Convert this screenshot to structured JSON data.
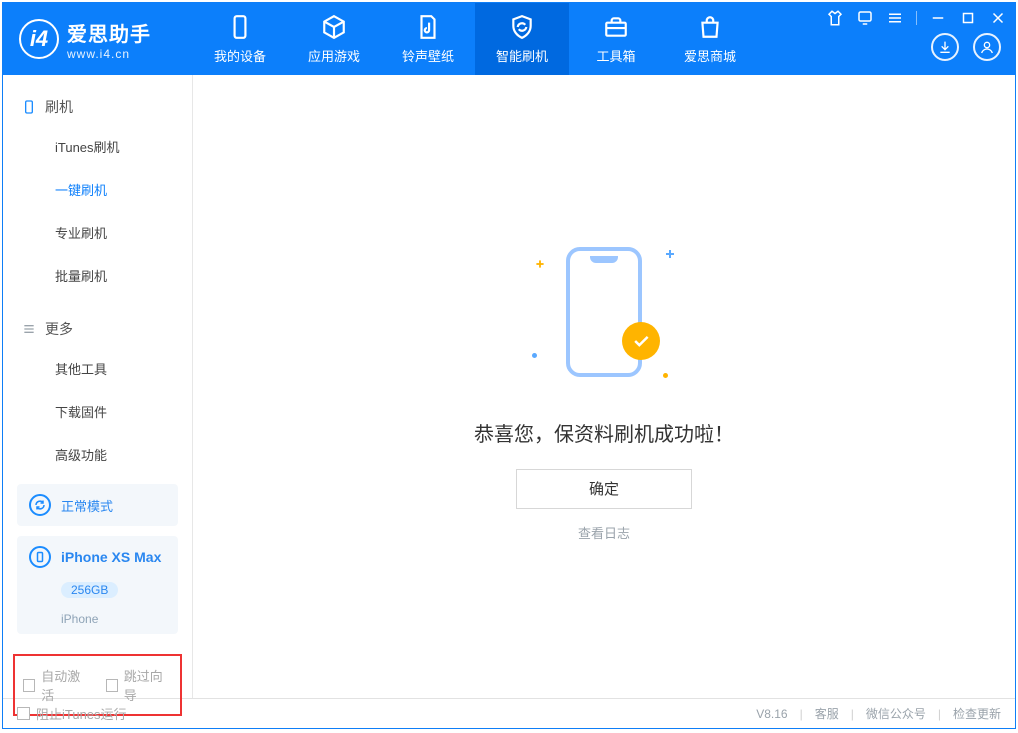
{
  "brand": {
    "title": "爱思助手",
    "subtitle": "www.i4.cn"
  },
  "tabs": {
    "device": "我的设备",
    "apps": "应用游戏",
    "rings": "铃声壁纸",
    "flash": "智能刷机",
    "tools": "工具箱",
    "store": "爱思商城"
  },
  "sidebar": {
    "heading_flash": "刷机",
    "items_flash": [
      "iTunes刷机",
      "一键刷机",
      "专业刷机",
      "批量刷机"
    ],
    "active_flash_index": 1,
    "heading_more": "更多",
    "items_more": [
      "其他工具",
      "下载固件",
      "高级功能"
    ]
  },
  "device_card": {
    "mode_label": "正常模式",
    "name": "iPhone XS Max",
    "storage": "256GB",
    "type": "iPhone"
  },
  "options": {
    "auto_activate": "自动激活",
    "skip_guide": "跳过向导"
  },
  "main": {
    "success_title": "恭喜您，保资料刷机成功啦！",
    "confirm_label": "确定",
    "view_log": "查看日志"
  },
  "statusbar": {
    "block_itunes": "阻止iTunes运行",
    "version": "V8.16",
    "service": "客服",
    "wechat": "微信公众号",
    "update": "检查更新"
  }
}
